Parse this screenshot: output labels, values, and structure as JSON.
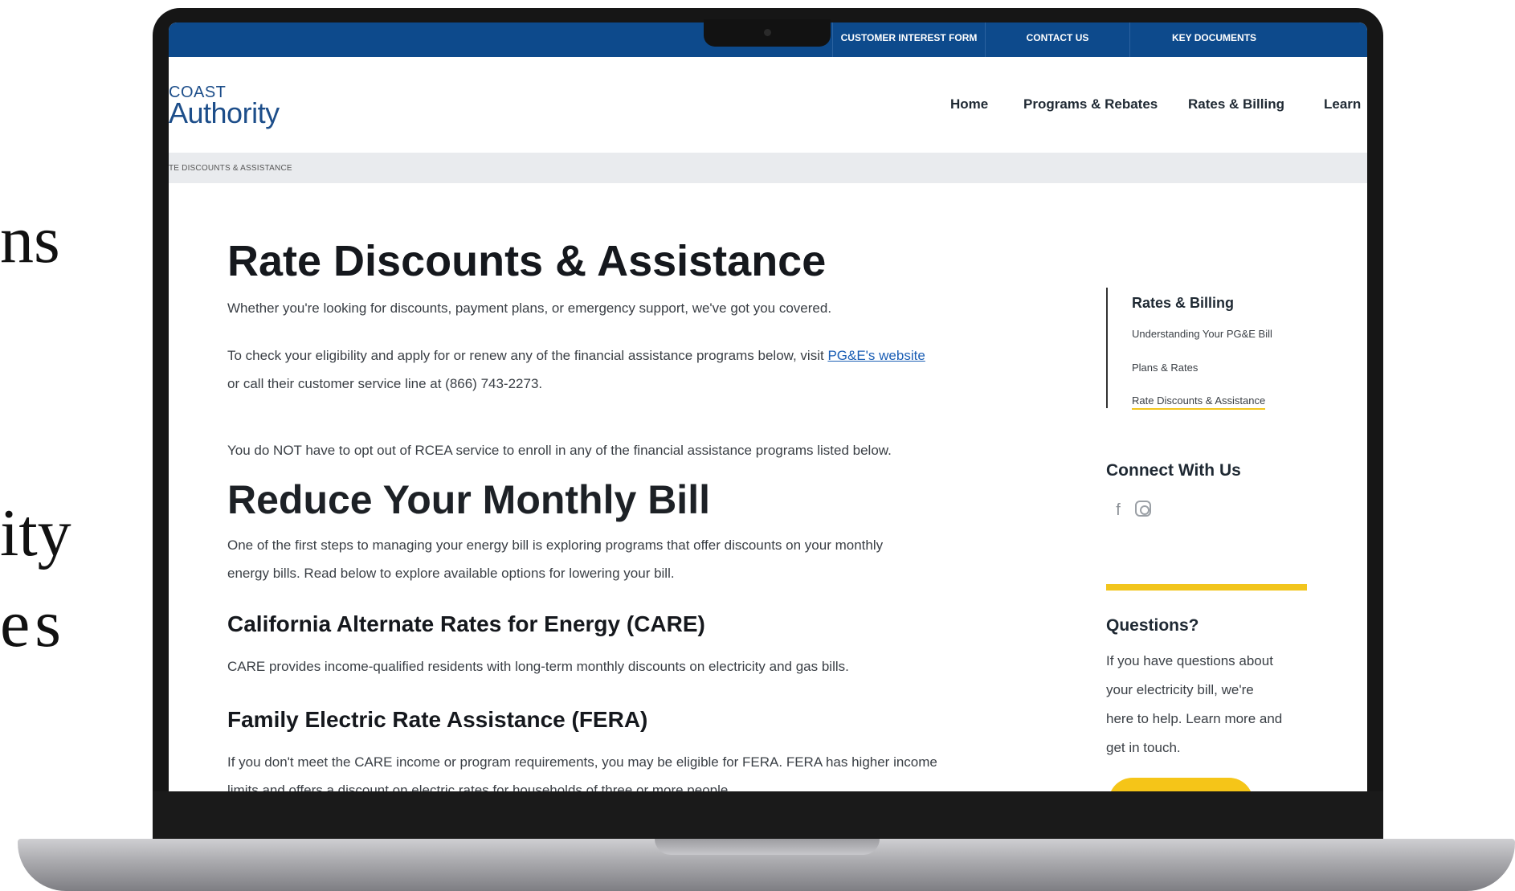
{
  "slide_fragments": [
    "ns",
    "ity",
    "es"
  ],
  "topbar": {
    "customer_interest_form": "CUSTOMER INTEREST FORM",
    "contact_us": "CONTACT US",
    "key_documents": "KEY DOCUMENTS",
    "color": "#0d4a8c"
  },
  "header": {
    "logo_line1": "COAST",
    "logo_line2": "Authority",
    "nav": [
      "Home",
      "Programs & Rebates",
      "Rates & Billing",
      "Learn"
    ]
  },
  "breadcrumb": "TE DISCOUNTS & ASSISTANCE",
  "main": {
    "title": "Rate Discounts & Assistance",
    "intro": "Whether you're looking for discounts, payment plans, or emergency support, we've got you covered.",
    "eligibility_pre": "To check your eligibility and apply for or renew any of the financial assistance programs below, visit ",
    "eligibility_link": "PG&E's website",
    "eligibility_post": "or call their customer service line at (866) 743-2273.",
    "opt_out": "You do NOT have to opt out of RCEA service to enroll in any of the financial assistance programs listed below.",
    "section_title": "Reduce Your Monthly Bill",
    "section_text_1": "One of the first steps to managing your energy bill is exploring programs that offer discounts on your monthly",
    "section_text_2": "energy bills. Read below to explore available options for lowering your bill.",
    "care_title": "California Alternate Rates for Energy (CARE)",
    "care_text": "CARE provides income-qualified residents with long-term monthly discounts on electricity and gas bills.",
    "fera_title": "Family Electric Rate Assistance (FERA)",
    "fera_text_1": "If you don't meet the CARE income or program requirements, you may be eligible for FERA. FERA has higher income",
    "fera_text_2": "limits and offers a discount on electric rates for households of three or more people."
  },
  "sidebar": {
    "section_title": "Rates & Billing",
    "items": [
      "Understanding Your PG&E Bill",
      "Plans & Rates",
      "Rate Discounts & Assistance"
    ],
    "connect_title": "Connect With Us",
    "social_icons": [
      "facebook-icon",
      "instagram-icon"
    ],
    "questions_title": "Questions?",
    "questions_lines": [
      "If you have questions about",
      "your electricity bill, we're",
      "here to help. Learn more and",
      "get in touch."
    ],
    "accent_color": "#f2c51d"
  }
}
